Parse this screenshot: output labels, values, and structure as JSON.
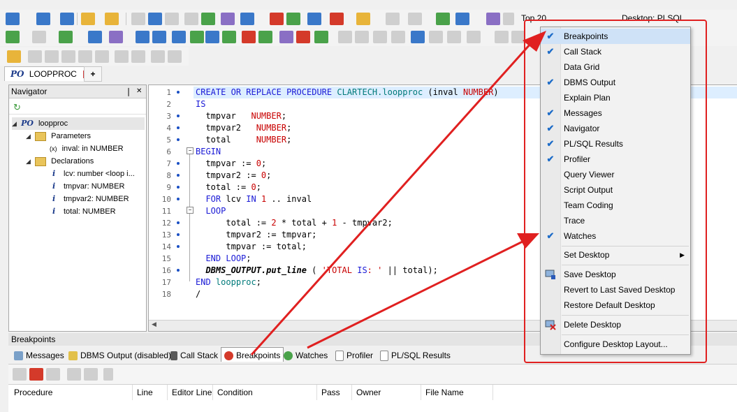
{
  "toolbar": {
    "top_n_value": "Top 20",
    "desktop_label": "Desktop:",
    "desktop_value": "PLSQL"
  },
  "editor_tab": {
    "icon_text": "PO",
    "label": "LOOPPROC",
    "add_label": "+"
  },
  "navigator": {
    "title": "Navigator",
    "pin": "❘",
    "close": "✕",
    "root": {
      "icon_text": "PO",
      "label": "loopproc"
    },
    "parameters": {
      "label": "Parameters",
      "items": [
        {
          "icon_text": "(x)",
          "label": "inval: in NUMBER"
        }
      ]
    },
    "declarations": {
      "label": "Declarations",
      "items": [
        {
          "label": "lcv: number <loop i..."
        },
        {
          "label": "tmpvar: NUMBER"
        },
        {
          "label": "tmpvar2: NUMBER"
        },
        {
          "label": "total: NUMBER"
        }
      ]
    }
  },
  "code": {
    "line_numbers": [
      "1",
      "2",
      "3",
      "4",
      "5",
      "6",
      "7",
      "8",
      "9",
      "10",
      "11",
      "12",
      "13",
      "14",
      "15",
      "16",
      "17",
      "18"
    ],
    "lines": [
      "CREATE OR REPLACE PROCEDURE CLARTECH.loopproc (inval NUMBER)",
      "IS",
      "  tmpvar   NUMBER;",
      "  tmpvar2   NUMBER;",
      "  total     NUMBER;",
      "BEGIN",
      "  tmpvar := 0;",
      "  tmpvar2 := 0;",
      "  total := 0;",
      "  FOR lcv IN 1 .. inval",
      "  LOOP",
      "      total := 2 * total + 1 - tmpvar2;",
      "      tmpvar2 := tmpvar;",
      "      tmpvar := total;",
      "  END LOOP;",
      "  DBMS_OUTPUT.put_line ( 'TOTAL IS: ' || total);",
      "END loopproc;",
      "/"
    ]
  },
  "bottom_panel": {
    "title": "Breakpoints",
    "tabs": [
      {
        "label": "Messages"
      },
      {
        "label": "DBMS Output (disabled)"
      },
      {
        "label": "Call Stack"
      },
      {
        "label": "Breakpoints"
      },
      {
        "label": "Watches"
      },
      {
        "label": "Profiler"
      },
      {
        "label": "PL/SQL Results"
      }
    ],
    "columns": [
      "Procedure",
      "Line",
      "Editor Line",
      "Condition",
      "Pass",
      "Owner",
      "File Name"
    ]
  },
  "context_menu": {
    "items": [
      {
        "label": "Breakpoints",
        "checked": "✔"
      },
      {
        "label": "Call Stack",
        "checked": "✔"
      },
      {
        "label": "Data Grid",
        "checked": ""
      },
      {
        "label": "DBMS Output",
        "checked": "✔"
      },
      {
        "label": "Explain Plan",
        "checked": ""
      },
      {
        "label": "Messages",
        "checked": "✔"
      },
      {
        "label": "Navigator",
        "checked": "✔"
      },
      {
        "label": "PL/SQL Results",
        "checked": "✔"
      },
      {
        "label": "Profiler",
        "checked": "✔"
      },
      {
        "label": "Query Viewer",
        "checked": ""
      },
      {
        "label": "Script Output",
        "checked": ""
      },
      {
        "label": "Team Coding",
        "checked": ""
      },
      {
        "label": "Trace",
        "checked": ""
      },
      {
        "label": "Watches",
        "checked": "✔"
      }
    ],
    "set_desktop": "Set Desktop",
    "submenu_arrow": "▶",
    "save_desktop": "Save Desktop",
    "revert_desktop": "Revert to Last Saved Desktop",
    "restore_desktop": "Restore Default Desktop",
    "delete_desktop": "Delete Desktop",
    "configure_desktop": "Configure Desktop Layout..."
  },
  "colors": {
    "annotation": "#e02020",
    "keyword": "#1a1ad6",
    "literal": "#c80000",
    "check": "#1d6cc8"
  }
}
